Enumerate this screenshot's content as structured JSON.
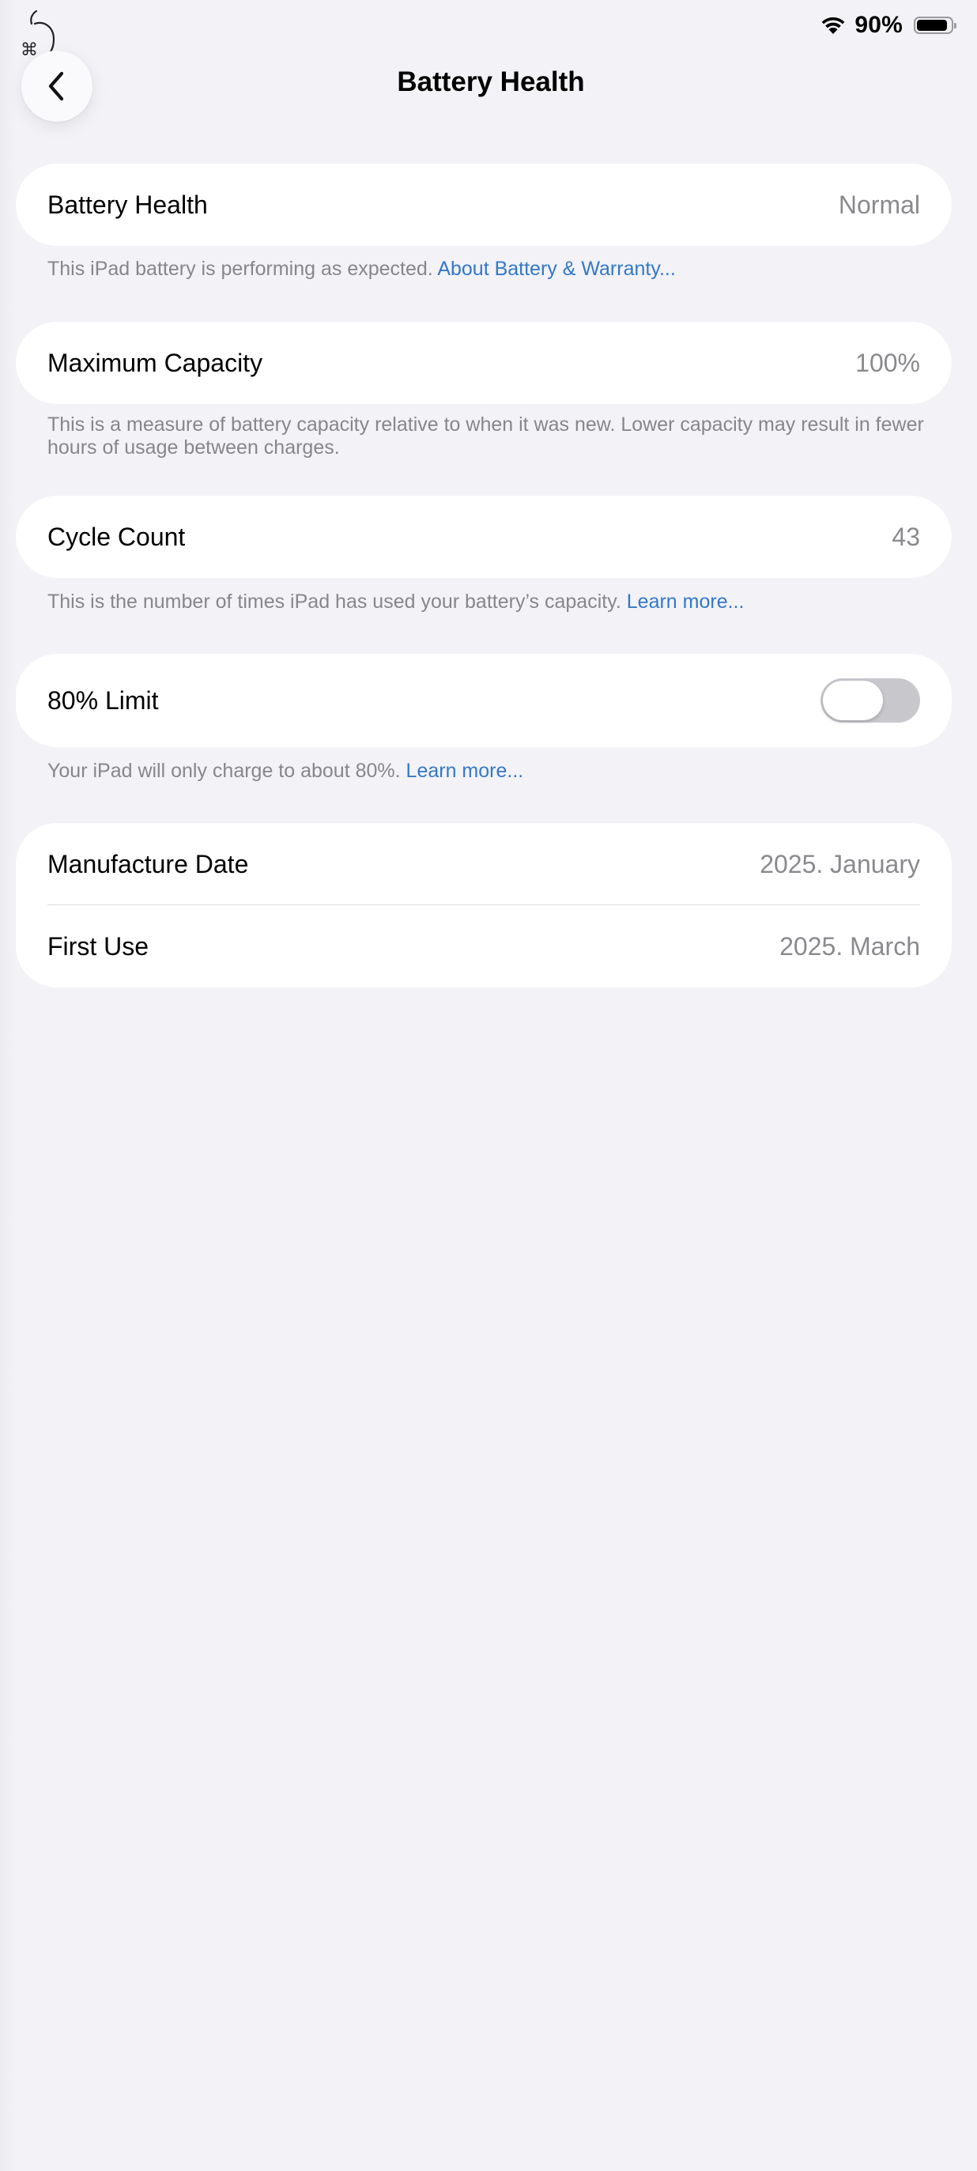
{
  "status_bar": {
    "battery_percent": "90%",
    "battery_level": 0.9,
    "wifi_icon": "wifi-icon",
    "battery_icon": "battery-icon"
  },
  "header": {
    "title": "Battery Health",
    "back_icon": "chevron-left-icon"
  },
  "sections": {
    "health": {
      "label": "Battery Health",
      "value": "Normal",
      "footnote": "This iPad battery is performing as expected.",
      "link": "About Battery & Warranty..."
    },
    "capacity": {
      "label": "Maximum Capacity",
      "value": "100%",
      "footnote": "This is a measure of battery capacity relative to when it was new. Lower capacity may result in fewer hours of usage between charges."
    },
    "cycles": {
      "label": "Cycle Count",
      "value": "43",
      "footnote": "This is the number of times iPad has used your battery’s capacity.",
      "link": "Learn more..."
    },
    "limit": {
      "label": "80% Limit",
      "enabled": false,
      "footnote": "Your iPad will only charge to about 80%.",
      "link": "Learn more..."
    },
    "dates": {
      "manufacture_label": "Manufacture Date",
      "manufacture_value": "2025. January",
      "first_use_label": "First Use",
      "first_use_value": "2025. March"
    }
  },
  "colors": {
    "background": "#f2f2f7",
    "card": "#ffffff",
    "link": "#3478c6",
    "secondary_text": "#86868b",
    "toggle_off": "#c7c7cc"
  }
}
